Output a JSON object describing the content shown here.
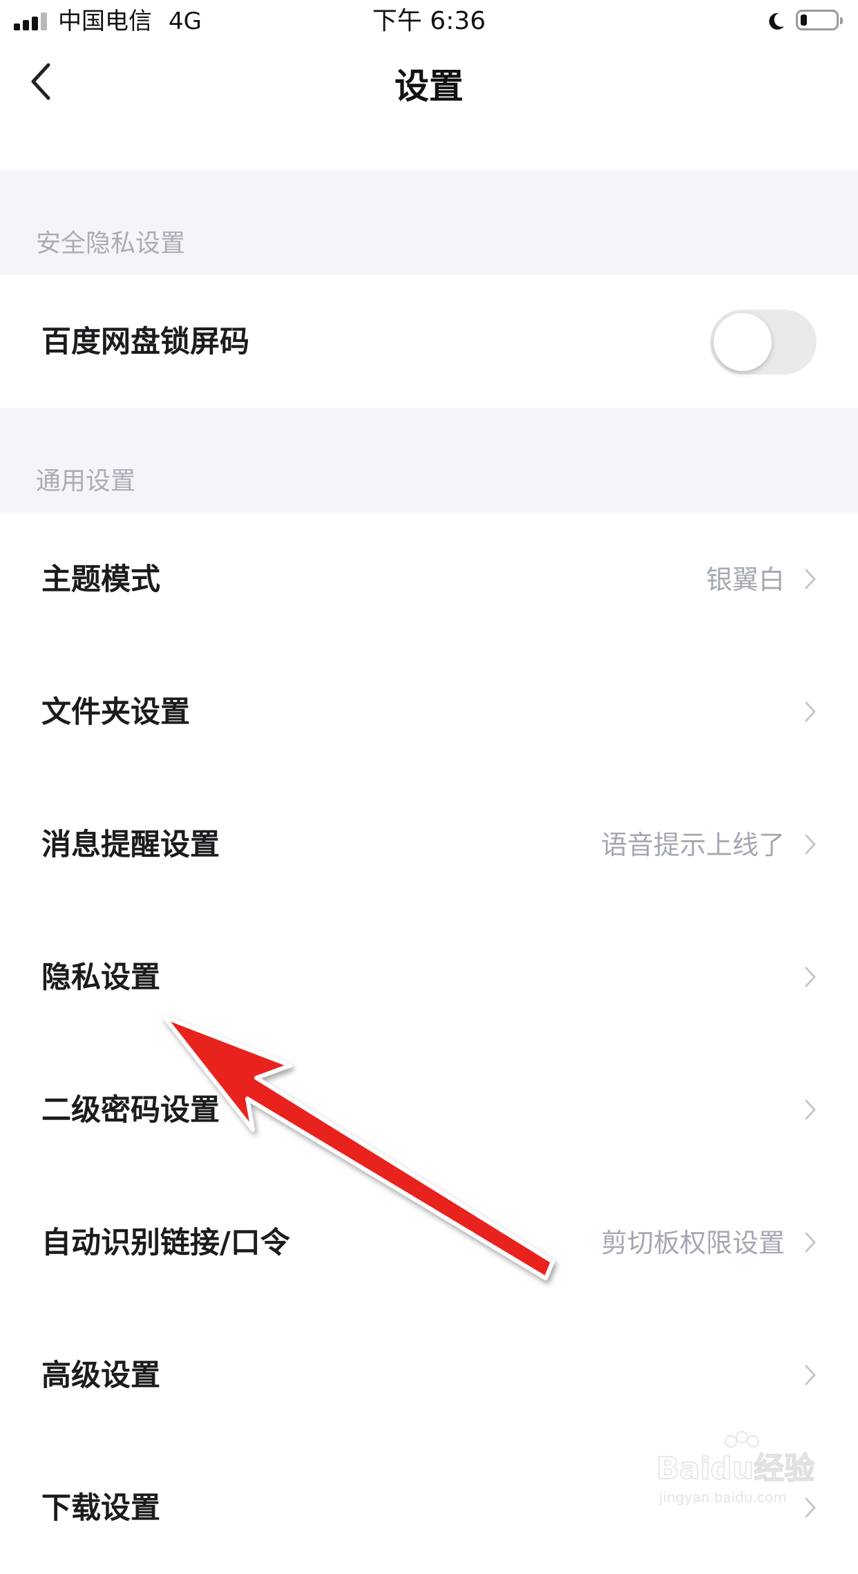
{
  "status_bar": {
    "carrier": "中国电信",
    "network": "4G",
    "time": "下午 6:36",
    "icons": [
      "signal-icon",
      "moon-icon",
      "battery-icon"
    ],
    "battery_level": 0.18
  },
  "nav": {
    "title": "设置",
    "back_icon": "chevron-left-icon"
  },
  "sections": {
    "privacy": {
      "header": "安全隐私设置",
      "lock_screen": {
        "label": "百度网盘锁屏码",
        "toggle_on": false
      }
    },
    "general": {
      "header": "通用设置",
      "items": [
        {
          "label": "主题模式",
          "value": "银翼白"
        },
        {
          "label": "文件夹设置",
          "value": ""
        },
        {
          "label": "消息提醒设置",
          "value": "语音提示上线了"
        },
        {
          "label": "隐私设置",
          "value": ""
        },
        {
          "label": "二级密码设置",
          "value": ""
        },
        {
          "label": "自动识别链接/口令",
          "value": "剪切板权限设置"
        },
        {
          "label": "高级设置",
          "value": ""
        },
        {
          "label": "下载设置",
          "value": ""
        }
      ]
    }
  },
  "annotation": {
    "type": "arrow",
    "color": "#e8221e",
    "points_to": "隐私设置"
  },
  "watermark": {
    "brand": "Baidu经验",
    "url": "jingyan.baidu.com"
  },
  "colors": {
    "section_bg": "#f4f5f8",
    "section_text": "#a9adb6",
    "value_text": "#a3a8b2",
    "title_text": "#1b1c1f"
  }
}
